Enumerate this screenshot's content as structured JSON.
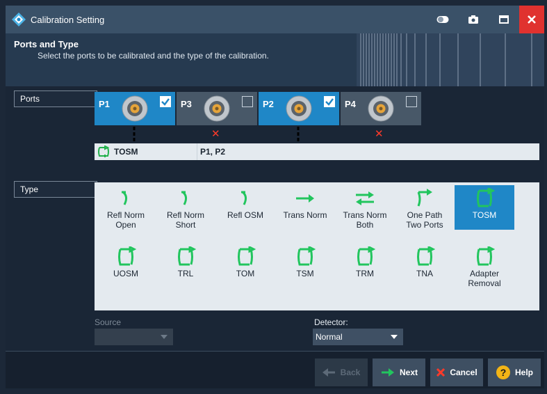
{
  "window": {
    "title": "Calibration Setting",
    "controls": [
      "toggle-icon",
      "camera-icon",
      "maximize-icon",
      "close-icon"
    ]
  },
  "header": {
    "title": "Ports and Type",
    "subtitle": "Select the ports to be calibrated and the type of the calibration."
  },
  "ports_section": {
    "label": "Ports",
    "ports": [
      {
        "label": "P1",
        "checked": true
      },
      {
        "label": "P3",
        "checked": false
      },
      {
        "label": "P2",
        "checked": true
      },
      {
        "label": "P4",
        "checked": false
      }
    ],
    "summary": {
      "type": "TOSM",
      "ports": "P1, P2"
    }
  },
  "type_section": {
    "label": "Type",
    "selected": "TOSM",
    "row1": [
      {
        "label": "Refl Norm",
        "label2": "Open",
        "icon": "refl-icon"
      },
      {
        "label": "Refl Norm",
        "label2": "Short",
        "icon": "refl-icon"
      },
      {
        "label": "Refl OSM",
        "label2": "",
        "icon": "refl-icon"
      },
      {
        "label": "Trans Norm",
        "label2": "",
        "icon": "trans-arrow-icon"
      },
      {
        "label": "Trans Norm",
        "label2": "Both",
        "icon": "trans-both-icon"
      },
      {
        "label": "One Path",
        "label2": "Two Ports",
        "icon": "one-path-icon"
      },
      {
        "label": "TOSM",
        "label2": "",
        "icon": "two-port-cal-icon"
      }
    ],
    "row2": [
      {
        "label": "UOSM",
        "label2": "",
        "icon": "two-port-cal-icon"
      },
      {
        "label": "TRL",
        "label2": "",
        "icon": "two-port-cal-icon"
      },
      {
        "label": "TOM",
        "label2": "",
        "icon": "two-port-cal-icon"
      },
      {
        "label": "TSM",
        "label2": "",
        "icon": "two-port-cal-icon"
      },
      {
        "label": "TRM",
        "label2": "",
        "icon": "two-port-cal-icon"
      },
      {
        "label": "TNA",
        "label2": "",
        "icon": "two-port-cal-icon"
      },
      {
        "label": "Adapter",
        "label2": "Removal",
        "icon": "two-port-cal-icon"
      }
    ]
  },
  "source": {
    "label": "Source",
    "value": ""
  },
  "detector": {
    "label": "Detector:",
    "value": "Normal"
  },
  "footer": {
    "back": "Back",
    "next": "Next",
    "cancel": "Cancel",
    "help": "Help"
  },
  "colors": {
    "accent": "#1f87c7",
    "green": "#22c55e",
    "close": "#e0322f",
    "panel": "#e4eaef"
  }
}
